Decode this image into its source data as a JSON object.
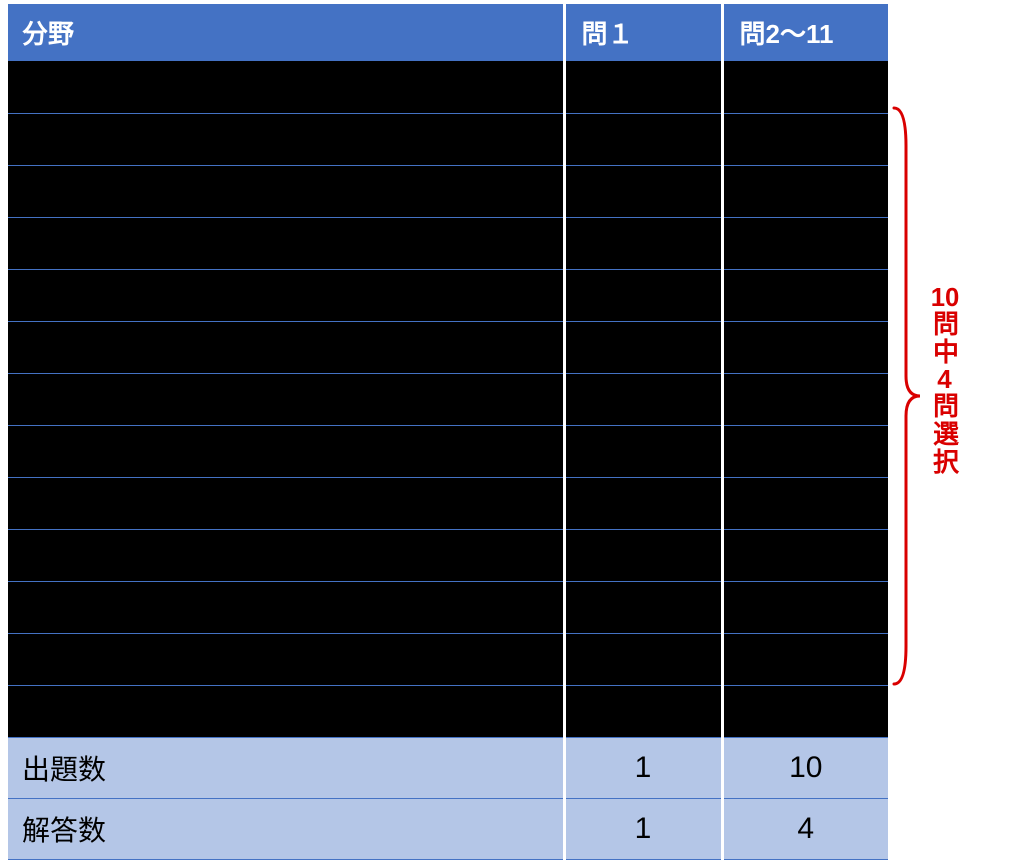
{
  "header": {
    "col1": "分野",
    "col2": "問１",
    "col3": "問2～11"
  },
  "body_row_count": 13,
  "footer": {
    "q_label": "出題数",
    "q_c2": "1",
    "q_c3": "10",
    "a_label": "解答数",
    "a_c2": "1",
    "a_c3": "4"
  },
  "annotation": {
    "line1_num": "10",
    "line1_rest": "問中",
    "line2_num": "4",
    "line2_rest": "問選択"
  },
  "colors": {
    "header_bg": "#4472c4",
    "footer_bg": "#b4c6e7",
    "body_bg": "#000000",
    "accent_red": "#d90000"
  }
}
